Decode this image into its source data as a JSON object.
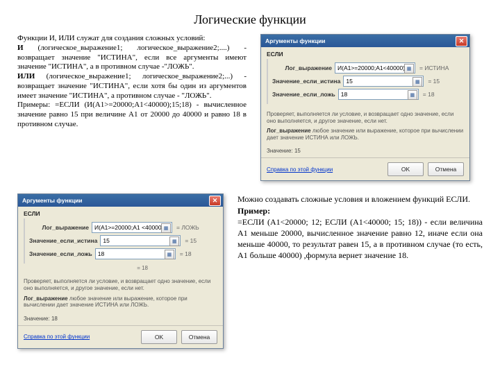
{
  "title": "Логические функции",
  "top_text": {
    "p1": "Функции И, ИЛИ служат для создания сложных условий:",
    "p2a": "И",
    "p2b": " (логическое_выражение1; логическое_выражение2;....) - возвращает значение \"ИСТИНА\", если все аргументы имеют значение \"ИСТИНА\", а в противном случае -\"ЛОЖЬ\".",
    "p3a": "ИЛИ",
    "p3b": " (логическое_выражение1; логическое_выражение2;...) - возвращает значение \"ИСТИНА\", если хотя бы один из аргументов имеет значение \"ИСТИНА\", а противном случае - \"ЛОЖЬ\".",
    "p4": "Примеры: =ЕСЛИ (И(A1>=20000;A1<40000);15;18) - вычисленное значение равно 15 при величине А1 от 20000 до 40000 и равно 18 в противном случае."
  },
  "bottom_text": {
    "p1": "Можно создавать сложные условия и вложением функций ЕСЛИ.",
    "p2": "Пример:",
    "p3": "=ЕСЛИ (A1<20000; 12; ЕСЛИ (A1<40000; 15; 18)) - если величина А1 меньше 20000, вычисленное значение равно 12, иначе если она меньше 40000, то результат равен 15, а в противном случае (то есть, А1 больше 40000) ,формула вернет значение 18."
  },
  "dialog1": {
    "title": "Аргументы функции",
    "fn": "ЕСЛИ",
    "rows": [
      {
        "label": "Лог_выражение",
        "value": "И(A1>=20000;A1<40000)",
        "eval": "= ИСТИНА"
      },
      {
        "label": "Значение_если_истина",
        "value": "15",
        "eval": "= 15"
      },
      {
        "label": "Значение_если_ложь",
        "value": "18",
        "eval": "= 18"
      }
    ],
    "main_desc": "Проверяет, выполняется ли условие, и возвращает одно значение, если оно выполняется, и другое значение, если нет.",
    "param_desc_label": "Лог_выражение",
    "param_desc": " любое значение или выражение, которое при вычислении дает значение ИСТИНА или ЛОЖЬ.",
    "result_label": "Значение:",
    "result": "15",
    "help": "Справка по этой функции",
    "ok": "OK",
    "cancel": "Отмена"
  },
  "dialog2": {
    "title": "Аргументы функции",
    "fn": "ЕСЛИ",
    "rows": [
      {
        "label": "Лог_выражение",
        "value": "И(A1>=20000;A1 <40000)",
        "eval": "= ЛОЖЬ"
      },
      {
        "label": "Значение_если_истина",
        "value": "15",
        "eval": "= 15"
      },
      {
        "label": "Значение_если_ложь",
        "value": "18",
        "eval": "= 18"
      }
    ],
    "pre_result": "= 18",
    "main_desc": "Проверяет, выполняется ли условие, и возвращает одно значение, если оно выполняется, и другое значение, если нет.",
    "param_desc_label": "Лог_выражение",
    "param_desc": " любое значение или выражение, которое при вычислении дает значение ИСТИНА или ЛОЖЬ.",
    "result_label": "Значение:",
    "result": "18",
    "help": "Справка по этой функции",
    "ok": "OK",
    "cancel": "Отмена"
  }
}
